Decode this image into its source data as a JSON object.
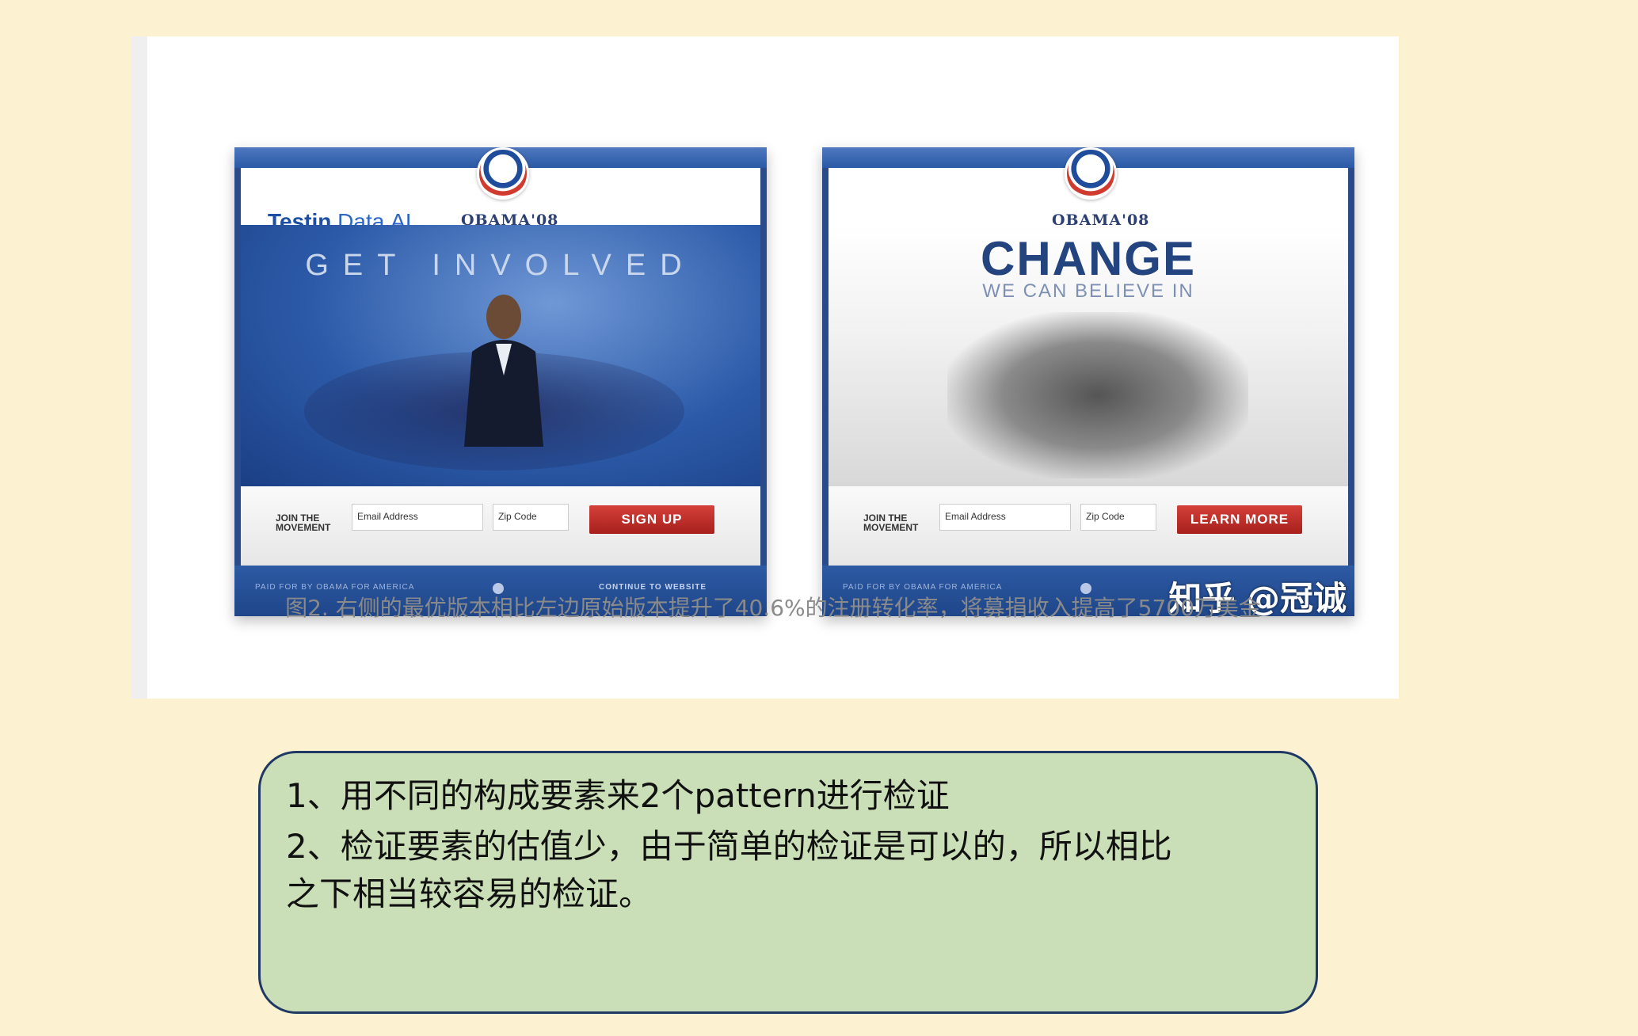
{
  "article": {
    "figure": {
      "left_variant": {
        "partner_logo_prefix": "Testin",
        "partner_logo_suffix": "Data.AI",
        "brand": "OBAMA'08",
        "headline": "GET INVOLVED",
        "form": {
          "join_label": "JOIN THE MOVEMENT",
          "email_placeholder": "Email Address",
          "zip_placeholder": "Zip Code",
          "cta_label": "SIGN UP"
        },
        "footer": {
          "left_text": "PAID FOR BY OBAMA FOR AMERICA",
          "right_text": "CONTINUE TO WEBSITE"
        }
      },
      "right_variant": {
        "brand": "OBAMA'08",
        "headline": "CHANGE",
        "subheadline": "WE CAN BELIEVE IN",
        "form": {
          "join_label": "JOIN THE MOVEMENT",
          "email_placeholder": "Email Address",
          "zip_placeholder": "Zip Code",
          "cta_label": "LEARN MORE"
        },
        "footer": {
          "left_text": "PAID FOR BY OBAMA FOR AMERICA"
        },
        "watermark": "知乎 @冠诚"
      },
      "caption": "图2. 右侧的最优版本相比左边原始版本提升了40.6%的注册转化率，将募捐收入提高了5700万美金"
    }
  },
  "note": {
    "line1": "1、用不同的构成要素来2个pattern进行检证",
    "line2": "2、检证要素的估值少，由于简单的检证是可以的，所以相比",
    "line3": "之下相当较容易的检证。"
  },
  "colors": {
    "page_background": "#fcf1d1",
    "note_background": "#cadfb8",
    "note_border": "#1f3864",
    "cta_red": "#c0302a",
    "obama_blue": "#23447f"
  }
}
